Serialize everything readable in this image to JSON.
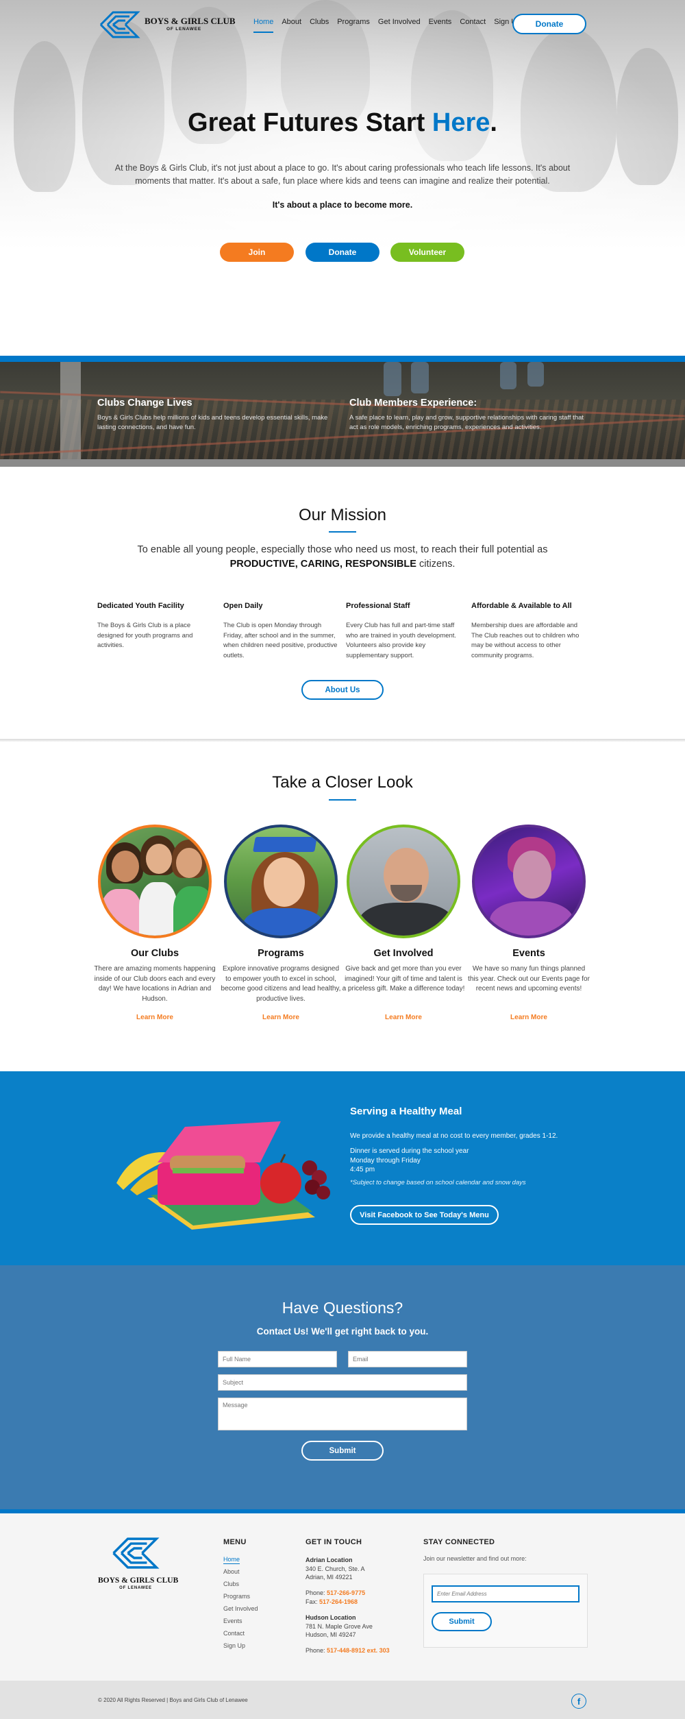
{
  "header": {
    "logo_line1": "BOYS & GIRLS CLUB",
    "logo_line2": "OF LENAWEE",
    "nav": [
      "Home",
      "About",
      "Clubs",
      "Programs",
      "Get Involved",
      "Events",
      "Contact",
      "Sign Up"
    ],
    "active_nav": "Home",
    "donate_label": "Donate"
  },
  "hero": {
    "title_main": "Great Futures Start ",
    "title_accent": "Here",
    "title_end": ".",
    "body": "At the Boys & Girls Club, it's not just about a place to go. It's about caring professionals who teach life lessons. It's about moments that matter. It's about a safe, fun place where kids and teens can imagine and realize their potential.",
    "tagline": "It's about a place to become more.",
    "buttons": {
      "join": "Join",
      "donate": "Donate",
      "volunteer": "Volunteer"
    }
  },
  "banner": {
    "left_title": "Clubs Change Lives",
    "left_text": "Boys & Girls Clubs help millions of kids and teens develop essential skills, make lasting connections, and have fun.",
    "right_title": "Club Members Experience:",
    "right_text": "A safe place to learn, play and grow, supportive relationships with caring staff that act as role models, enriching programs, experiences and activities."
  },
  "mission": {
    "title": "Our Mission",
    "text_before": "To enable all young people, especially those who need us most, to reach their full potential as ",
    "text_strong": "PRODUCTIVE, CARING, RESPONSIBLE",
    "text_after": " citizens.",
    "features": [
      {
        "title": "Dedicated Youth Facility",
        "text": "The Boys & Girls Club is a place designed for youth programs and activities."
      },
      {
        "title": "Open Daily",
        "text": "The Club is open Monday through Friday, after school and in the summer, when children need positive, productive outlets."
      },
      {
        "title": "Professional Staff",
        "text": "Every Club has full and part-time staff who are trained in youth development. Volunteers also provide key supplementary support."
      },
      {
        "title": "Affordable & Available to All",
        "text": "Membership dues are affordable and The Club reaches out to children who may be without access to other community programs."
      }
    ],
    "about_label": "About Us"
  },
  "closer": {
    "title": "Take a Closer Look",
    "cards": [
      {
        "title": "Our Clubs",
        "text": "There are amazing moments happening inside of our Club doors each and every day! We have locations in Adrian and Hudson.",
        "link": "Learn More",
        "ring": "#f47b20"
      },
      {
        "title": "Programs",
        "text": "Explore innovative programs designed to empower youth to excel in school, become good citizens and lead healthy, productive lives.",
        "link": "Learn More",
        "ring": "#1f3f74"
      },
      {
        "title": "Get Involved",
        "text": "Give back and get more than you ever imagined! Your gift of time and talent is a priceless gift. Make a difference today!",
        "link": "Learn More",
        "ring": "#78be20"
      },
      {
        "title": "Events",
        "text": "We have so many fun things planned this year. Check out our Events page for recent news and upcoming events!",
        "link": "Learn More",
        "ring": "#5b2c8f"
      }
    ]
  },
  "meal": {
    "title": "Serving a Healthy Meal",
    "p1": "We provide a healthy meal at no cost to every member, grades 1-12.",
    "p2_lines": [
      "Dinner is served during the school year",
      "Monday through Friday",
      "4:45 pm"
    ],
    "note": "*Subject to change based on school calendar and snow days",
    "button": "Visit Facebook to See Today's Menu"
  },
  "contact": {
    "title": "Have Questions?",
    "subtitle": "Contact Us! We'll get right back to you.",
    "placeholders": {
      "name": "Full Name",
      "email": "Email",
      "subject": "Subject",
      "message": "Message"
    },
    "submit": "Submit"
  },
  "footer": {
    "logo_line1": "BOYS & GIRLS CLUB",
    "logo_line2": "OF LENAWEE",
    "menu_heading": "MENU",
    "menu": [
      "Home",
      "About",
      "Clubs",
      "Programs",
      "Get Involved",
      "Events",
      "Contact",
      "Sign Up"
    ],
    "touch_heading": "GET IN TOUCH",
    "loc1": {
      "name": "Adrian Location",
      "addr1": "340 E. Church, Ste. A",
      "addr2": "Adrian, MI 49221",
      "phone_label": "Phone: ",
      "phone": "517-266-9775",
      "fax_label": "Fax: ",
      "fax": "517-264-1968"
    },
    "loc2": {
      "name": "Hudson Location",
      "addr1": "781 N. Maple Grove Ave",
      "addr2": "Hudson, MI 49247",
      "phone_label": "Phone: ",
      "phone": "517-448-8912 ext. 303"
    },
    "stay_heading": "STAY CONNECTED",
    "stay_text": "Join our newsletter and find out more:",
    "email_placeholder": "Enter Email Address",
    "submit": "Submit",
    "copyright": "© 2020 All Rights Reserved | Boys and Girls Club of Lenawee",
    "social_icon": "facebook-icon"
  },
  "colors": {
    "blue": "#0077c8",
    "orange": "#f47b20",
    "green": "#78be20",
    "meal_bg": "#0a80c8",
    "contact_bg": "#3b7bb1"
  }
}
